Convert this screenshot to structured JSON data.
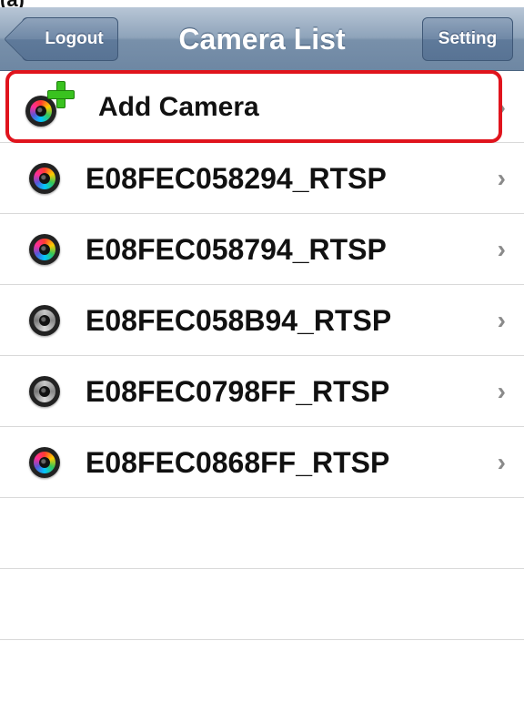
{
  "top_label": "(a)",
  "navbar": {
    "title": "Camera List",
    "back_label": "Logout",
    "right_label": "Setting"
  },
  "add_row": {
    "label": "Add Camera",
    "chevron": "›",
    "icon": "camera-add-icon"
  },
  "cameras": [
    {
      "label": "E08FEC058294_RTSP",
      "status": "online"
    },
    {
      "label": "E08FEC058794_RTSP",
      "status": "online"
    },
    {
      "label": "E08FEC058B94_RTSP",
      "status": "offline"
    },
    {
      "label": "E08FEC0798FF_RTSP",
      "status": "offline"
    },
    {
      "label": "E08FEC0868FF_RTSP",
      "status": "online"
    }
  ],
  "chevron": "›",
  "colors": {
    "highlight": "#e0141d",
    "plus": "#39c21f",
    "navbar": "#7890aa"
  }
}
